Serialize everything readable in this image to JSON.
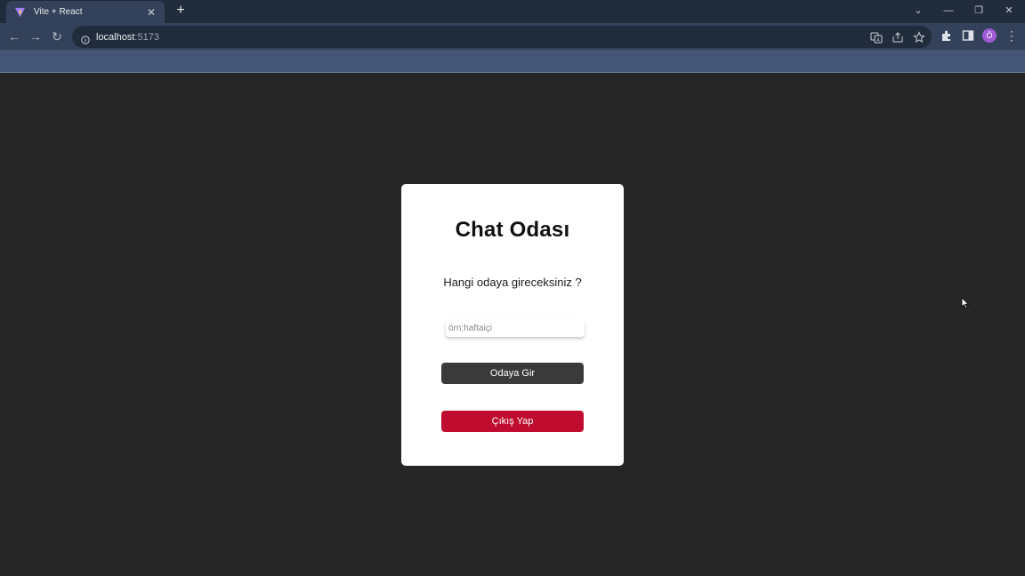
{
  "browser": {
    "tab": {
      "title": "Vite + React",
      "close_glyph": "✕",
      "favicon": "vite-logo-icon"
    },
    "new_tab_glyph": "+",
    "window_controls": {
      "tab_search": "⌄",
      "minimize": "—",
      "restore": "❐",
      "close": "✕"
    },
    "nav": {
      "back": "←",
      "forward": "→",
      "reload": "↻"
    },
    "url": {
      "host": "localhost",
      "port": ":5173"
    },
    "profile_initial": "Ö",
    "menu_glyph": "⋮"
  },
  "page": {
    "title": "Chat Odası",
    "question": "Hangi odaya gireceksiniz ?",
    "room_input": {
      "placeholder": "örn:haftaiçi",
      "value": ""
    },
    "enter_button": "Odaya Gir",
    "exit_button": "Çıkış Yap"
  },
  "colors": {
    "background": "#262626",
    "card": "#ffffff",
    "enter_button": "#3a3a3a",
    "exit_button": "#bf0c2f"
  }
}
